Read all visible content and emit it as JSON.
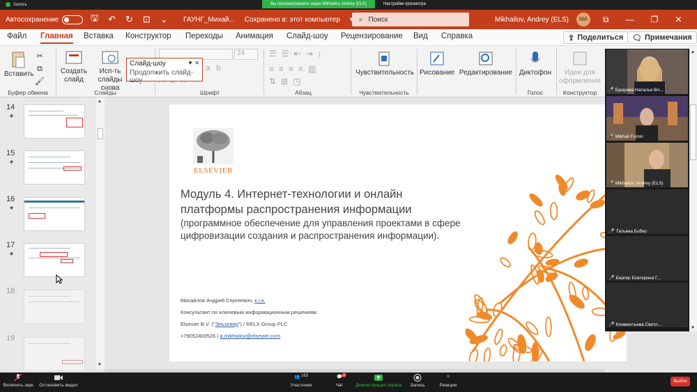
{
  "zoom_top": {
    "recording": "Запись",
    "sharing_banner": "Вы просматриваете экран Mikhailov, Andrey (ELS)",
    "view_options": "Настройки просмотра"
  },
  "titlebar": {
    "autosave_label": "Автосохранение",
    "autosave_state": "Откл.",
    "doc_title": "ГАУНГ_Михай...",
    "saved_status": "Сохранено в: этот компьютер",
    "search_placeholder": "Поиск",
    "user": "Mikhailov, Andrey (ELS)",
    "avatar_initials": "MA"
  },
  "tabs": [
    "Файл",
    "Главная",
    "Вставка",
    "Конструктор",
    "Переходы",
    "Анимация",
    "Слайд-шоу",
    "Рецензирование",
    "Вид",
    "Справка"
  ],
  "active_tab": "Главная",
  "share_button": "Поделиться",
  "comments_button": "Примечания",
  "ribbon": {
    "paste": "Вставить",
    "clipboard_group": "Буфер обмена",
    "new_slide": "Создать слайд",
    "reuse_slides": "Исп-ть слайды снова",
    "slides_group": "Слайды",
    "font_group": "Шрифт",
    "font_size": "24",
    "paragraph_group": "Абзац",
    "sensitivity": "Чувствительность",
    "sensitivity_group": "Чувствительность",
    "drawing": "Рисование",
    "editing": "Редактирование",
    "dictate": "Диктофон",
    "voice_group": "Голос",
    "design_ideas": "Идеи для оформления",
    "designer_group": "Конструктор"
  },
  "tooltip": {
    "title": "Слайд-шоу",
    "item": "Продолжить слайд-шоу"
  },
  "thumbnails": [
    {
      "num": "14",
      "star": "★"
    },
    {
      "num": "15",
      "star": "★"
    },
    {
      "num": "16",
      "star": "★"
    },
    {
      "num": "17",
      "star": "★"
    },
    {
      "num": "18",
      "star": ""
    },
    {
      "num": "19",
      "star": ""
    }
  ],
  "slide": {
    "logo_text": "ELSEVIER",
    "title_line1": "Модуль 4. Интернет-технологии и онлайн",
    "title_line2": "платформы распространения информации",
    "subtitle_line1": "(программное обеспечение для управления проектами в сфере",
    "subtitle_line2": "цифровизации создания и распространения информации).",
    "author_name": "Михайлов Андрей Сергеевич,",
    "author_degree": "к.г.н.",
    "position": "Консультант по ключевым информационным решениям",
    "company_prefix": "Elsevier B.V. (\"",
    "company_link": "Эльзевир",
    "company_suffix": "\") / RELX Group PLC",
    "phone": "+79052400526 |",
    "email": "a.mikhailov@elsevier.com"
  },
  "participants": [
    {
      "name": "Бушуева Наталья Вл...",
      "video": true,
      "bg": "#7b6a5a"
    },
    {
      "name": "Mikhail Fomin",
      "video": true,
      "bg": "#5a4a6a"
    },
    {
      "name": "Mikhailov, Andrey (ELS)",
      "video": true,
      "bg": "#8a7a5a"
    },
    {
      "name": "Татьяна Бобко",
      "video": false
    },
    {
      "name": "Бергер Екатерина Г...",
      "video": false
    },
    {
      "name": "Климентьева Светл...",
      "video": false
    }
  ],
  "zoom_bottom": {
    "unmute": "Включить звук",
    "stop_video": "Остановить видео",
    "participants": "Участники",
    "participants_count": "163",
    "chat": "Чат",
    "chat_badge": "3",
    "share_screen": "Демонстрация экрана",
    "record": "Запись",
    "reactions": "Реакции",
    "leave": "Выйти"
  }
}
